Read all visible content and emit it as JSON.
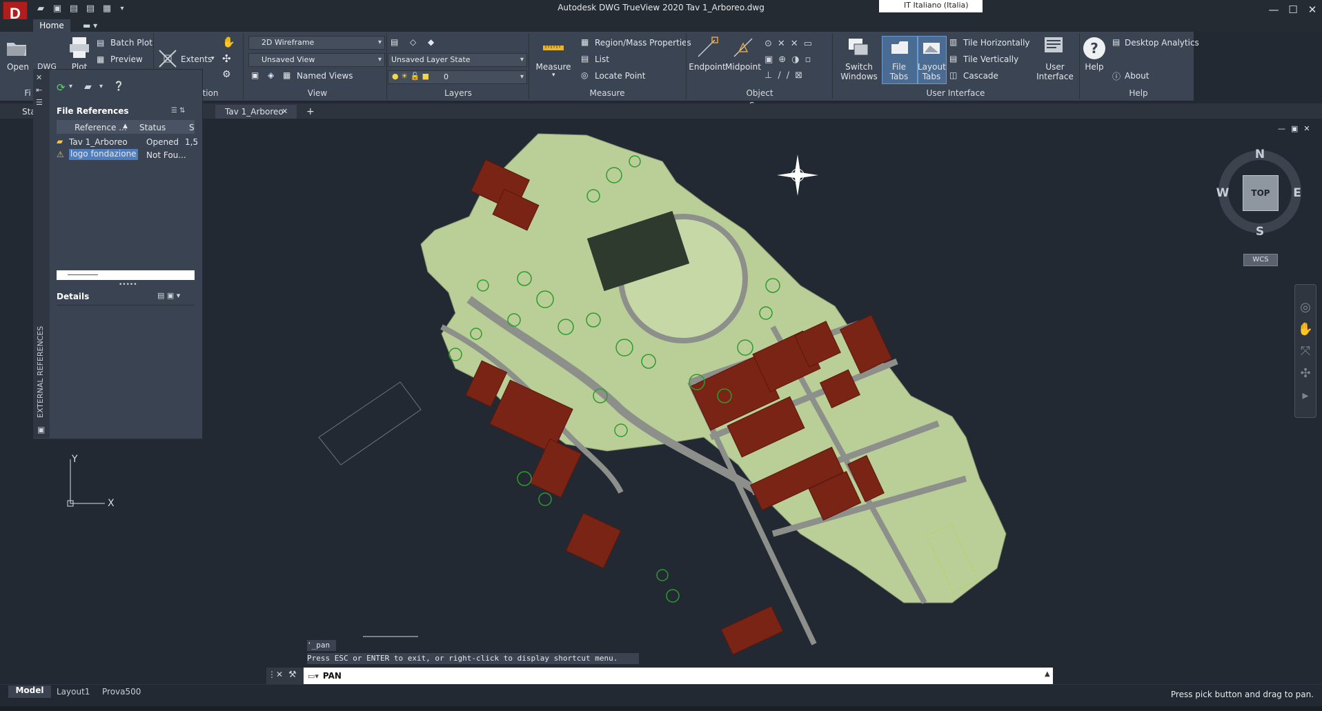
{
  "window": {
    "title": "Autodesk DWG TrueView 2020   Tav 1_Arboreo.dwg",
    "language": "IT  Italiano (Italia)",
    "app_logo": "D"
  },
  "ribbon": {
    "tab_home": "Home",
    "files": {
      "open": "Open",
      "dwg": "DWG",
      "plot": "Plot",
      "batch_plot": "Batch Plot",
      "preview": "Preview",
      "panel_fi": "Fi"
    },
    "navigation": {
      "extents": "Extents",
      "panel": "tion"
    },
    "view": {
      "visual_style": "2D Wireframe",
      "saved_view": "Unsaved View",
      "named_views": "Named Views",
      "panel": "View"
    },
    "layers": {
      "layer_state": "Unsaved Layer State",
      "current_layer": "0",
      "panel": "Layers"
    },
    "measure": {
      "measure": "Measure",
      "region_mass": "Region/Mass Properties",
      "list": "List",
      "locate_point": "Locate Point",
      "panel": "Measure"
    },
    "osnap": {
      "endpoint": "Endpoint",
      "midpoint": "Midpoint",
      "panel": "Object Snap"
    },
    "ui": {
      "switch_windows_1": "Switch",
      "switch_windows_2": "Windows",
      "file_tabs": "File Tabs",
      "layout_tabs_1": "Layout",
      "layout_tabs_2": "Tabs",
      "tile_h": "Tile Horizontally",
      "tile_v": "Tile Vertically",
      "cascade": "Cascade",
      "user_interface_1": "User",
      "user_interface_2": "Interface",
      "panel": "User Interface"
    },
    "help": {
      "help": "Help",
      "desktop_analytics": "Desktop Analytics",
      "about": "About",
      "panel": "Help"
    }
  },
  "doc_tabs": {
    "start": "Sta",
    "current": "Tav 1_Arboreo"
  },
  "xref_palette": {
    "side_title": "EXTERNAL REFERENCES",
    "file_references": "File References",
    "columns": {
      "reference": "Reference ...",
      "status": "Status",
      "size": "S"
    },
    "rows": [
      {
        "name": "Tav 1_Arboreo",
        "status": "Opened",
        "size": "1,5"
      },
      {
        "name": "logo fondazione",
        "status": "Not Fou...",
        "size": ""
      }
    ],
    "details": "Details"
  },
  "viewcube": {
    "n": "N",
    "s": "S",
    "e": "E",
    "w": "W",
    "top": "TOP",
    "wcs": "WCS"
  },
  "ucs": {
    "y": "Y",
    "x": "X"
  },
  "command": {
    "history_1": "'_pan",
    "history_2": "Press ESC or ENTER to exit, or right-click to display shortcut menu.",
    "input": "PAN"
  },
  "layout_tabs": [
    "Model",
    "Layout1",
    "Prova500"
  ],
  "status_message": "Press pick button and drag to pan.",
  "colors": {
    "ribbon": "#3b4453",
    "canvas": "#222933",
    "lawn": "#b9cf97",
    "roof": "#7a2416",
    "road": "#8d8f8a",
    "tree": "#2e9a2e"
  }
}
